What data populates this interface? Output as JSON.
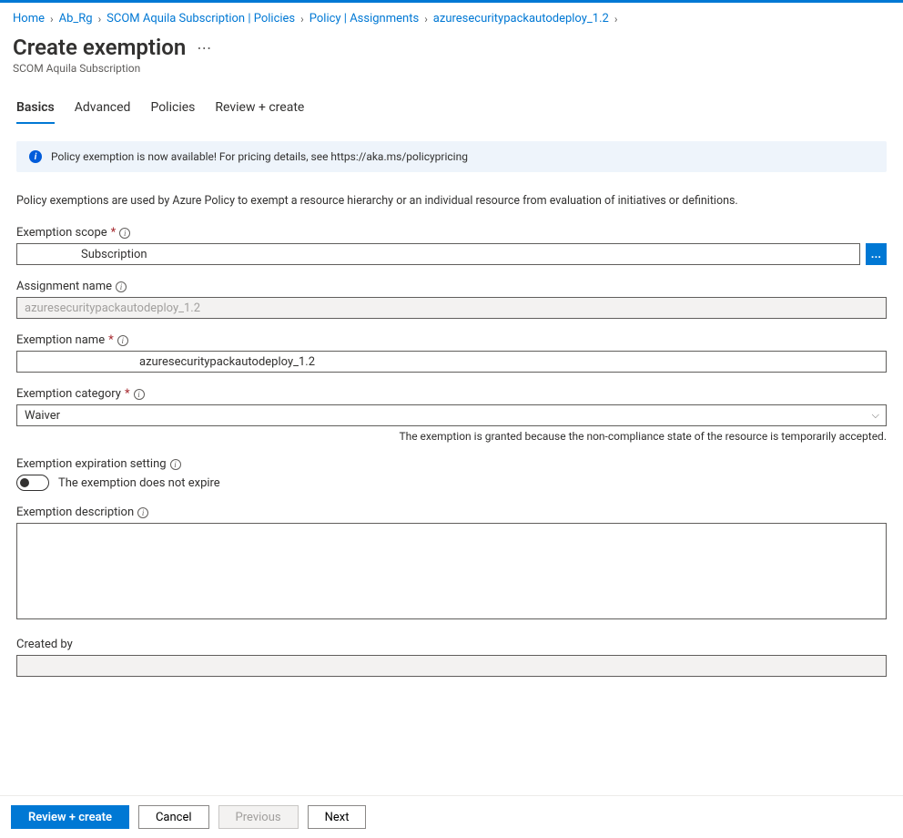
{
  "breadcrumb": {
    "items": [
      {
        "label": "Home"
      },
      {
        "label": "Ab_Rg"
      },
      {
        "label": "SCOM Aquila Subscription | Policies"
      },
      {
        "label": "Policy | Assignments"
      },
      {
        "label": "azuresecuritypackautodeploy_1.2"
      }
    ]
  },
  "header": {
    "title": "Create exemption",
    "subtitle": "SCOM Aquila Subscription"
  },
  "tabs": [
    {
      "label": "Basics",
      "active": true
    },
    {
      "label": "Advanced"
    },
    {
      "label": "Policies"
    },
    {
      "label": "Review + create"
    }
  ],
  "banner": {
    "text": "Policy exemption is now available! For pricing details, see https://aka.ms/policypricing"
  },
  "description": "Policy exemptions are used by Azure Policy to exempt a resource hierarchy or an individual resource from evaluation of initiatives or definitions.",
  "form": {
    "scope": {
      "label": "Exemption scope",
      "value": "Subscription",
      "scopeButton": "…"
    },
    "assignment": {
      "label": "Assignment name",
      "value": "azuresecuritypackautodeploy_1.2"
    },
    "name": {
      "label": "Exemption name",
      "value": "azuresecuritypackautodeploy_1.2"
    },
    "category": {
      "label": "Exemption category",
      "value": "Waiver",
      "hint": "The exemption is granted because the non-compliance state of the resource is temporarily accepted."
    },
    "expiration": {
      "label": "Exemption expiration setting",
      "toggleText": "The exemption does not expire"
    },
    "descField": {
      "label": "Exemption description",
      "value": ""
    },
    "createdBy": {
      "label": "Created by",
      "value": ""
    }
  },
  "footer": {
    "review": "Review + create",
    "cancel": "Cancel",
    "previous": "Previous",
    "next": "Next"
  }
}
